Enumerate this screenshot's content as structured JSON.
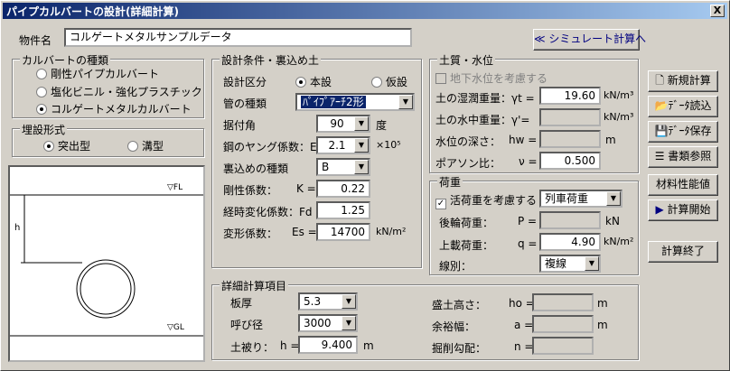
{
  "window": {
    "title": "パイプカルバートの設計(詳細計算)",
    "close": "X"
  },
  "header": {
    "item_name_label": "物件名",
    "item_name_value": "コルゲートメタルサンプルデータ",
    "simulate_button": "≪ シミュレート計算へ"
  },
  "culvert_type": {
    "title": "カルバートの種類",
    "options": [
      "剛性パイプカルバート",
      "塩化ビニル・強化プラスチック",
      "コルゲートメタルカルバート"
    ],
    "selected": 2
  },
  "burial": {
    "title": "埋設形式",
    "options": [
      "突出型",
      "溝型"
    ],
    "selected": 0
  },
  "diagram": {
    "fl": "▽FL",
    "gl": "▽GL",
    "h": "h"
  },
  "design": {
    "title": "設計条件・裏込め土",
    "class_label": "設計区分",
    "class_options": [
      "本設",
      "仮設"
    ],
    "class_selected": 0,
    "pipe_type_label": "管の種類",
    "pipe_type_value": "ﾊﾟｲﾌﾟｱｰﾁ2形",
    "bedding_angle_label": "据付角",
    "bedding_angle_value": "90",
    "bedding_angle_unit": "度",
    "young_label": "鋼のヤング係数：E =",
    "young_value": "2.1",
    "young_unit": "×10⁵",
    "backfill_label": "裏込めの種類",
    "backfill_value": "B",
    "rigidity_label": "剛性係数：",
    "rigidity_sym": "K =",
    "rigidity_value": "0.22",
    "aging_label": "経時変化係数：Fd =",
    "aging_value": "1.25",
    "deform_label": "変形係数：",
    "deform_sym": "Es =",
    "deform_value": "14700",
    "deform_unit": "kN/m²"
  },
  "soil": {
    "title": "土質・水位",
    "groundwater_label": "地下水位を考慮する",
    "wet_weight_label": "土の湿潤重量：γt =",
    "wet_weight_value": "19.60",
    "wet_weight_unit": "kN/m³",
    "sub_weight_label": "土の水中重量：γ'=",
    "sub_weight_value": "",
    "sub_weight_unit": "kN/m³",
    "water_depth_label": "水位の深さ：",
    "water_depth_sym": "hw =",
    "water_depth_value": "",
    "water_depth_unit": "m",
    "poisson_label": "ポアソン比：",
    "poisson_sym": "ν =",
    "poisson_value": "0.500"
  },
  "load": {
    "title": "荷重",
    "live_label": "活荷重を考慮する",
    "live_type_value": "列車荷重",
    "rear_label": "後輪荷重：",
    "rear_sym": "P =",
    "rear_value": "",
    "rear_unit": "kN",
    "upper_label": "上載荷重：",
    "upper_sym": "q =",
    "upper_value": "4.90",
    "upper_unit": "kN/m²",
    "line_label": "線別：",
    "line_value": "複線"
  },
  "detail": {
    "title": "詳細計算項目",
    "thickness_label": "板厚",
    "thickness_value": "5.3",
    "diameter_label": "呼び径",
    "diameter_value": "3000",
    "cover_label": "土被り：",
    "cover_sym": "h =",
    "cover_value": "9.400",
    "cover_unit": "m",
    "fill_height_label": "盛土高さ：",
    "fill_height_sym": "ho =",
    "fill_height_unit": "m",
    "margin_label": "余裕幅：",
    "margin_sym": "a =",
    "margin_unit": "m",
    "slope_label": "掘削勾配：",
    "slope_sym": "n ="
  },
  "buttons": {
    "new": "新規計算",
    "load": "ﾃﾞｰﾀ読込",
    "save": "ﾃﾞｰﾀ保存",
    "refs": "書類参照",
    "material": "材料性能値",
    "start": "計算開始",
    "end": "計算終了"
  }
}
